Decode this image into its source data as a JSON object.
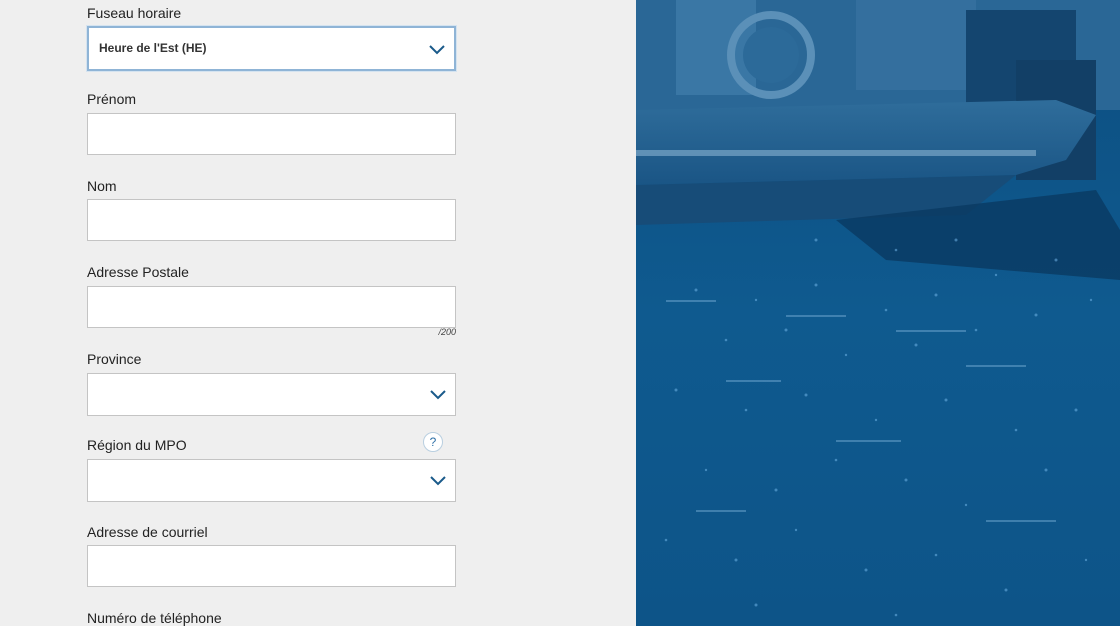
{
  "form": {
    "timezone": {
      "label": "Fuseau horaire",
      "value": "Heure de l'Est (HE)",
      "chevron_icon": "chevron-down-icon"
    },
    "first_name": {
      "label": "Prénom",
      "value": ""
    },
    "last_name": {
      "label": "Nom",
      "value": ""
    },
    "postal_address": {
      "label": "Adresse Postale",
      "value": "",
      "counter": "/200"
    },
    "province": {
      "label": "Province",
      "value": "",
      "chevron_icon": "chevron-down-icon"
    },
    "dfo_region": {
      "label": "Région du MPO",
      "value": "",
      "help_icon": "help-icon",
      "help_symbol": "?",
      "chevron_icon": "chevron-down-icon"
    },
    "email": {
      "label": "Adresse de courriel",
      "value": ""
    },
    "phone": {
      "label": "Numéro de téléphone"
    }
  },
  "colors": {
    "page_background": "#efefef",
    "accent_blue": "#1a5a8a",
    "image_overlay": "#0f5a8f"
  },
  "image_panel": {
    "icon": "boat-photo-image"
  }
}
